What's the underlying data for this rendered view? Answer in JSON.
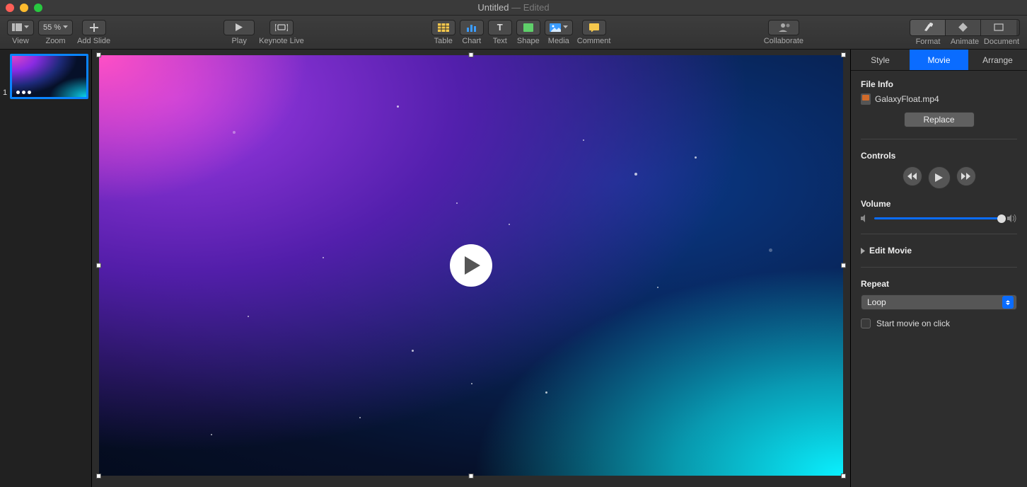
{
  "window": {
    "title": "Untitled",
    "subtitle": " — Edited"
  },
  "toolbar": {
    "view": "View",
    "zoom_value": "55 %",
    "zoom": "Zoom",
    "add_slide": "Add Slide",
    "play": "Play",
    "keynote_live": "Keynote Live",
    "table": "Table",
    "chart": "Chart",
    "text": "Text",
    "shape": "Shape",
    "media": "Media",
    "comment": "Comment",
    "collaborate": "Collaborate",
    "format": "Format",
    "animate": "Animate",
    "document": "Document"
  },
  "navigator": {
    "slides": [
      {
        "number": "1"
      }
    ]
  },
  "inspector": {
    "tabs": {
      "style": "Style",
      "movie": "Movie",
      "arrange": "Arrange"
    },
    "active_tab": "Movie",
    "file_info_label": "File Info",
    "file_name": "GalaxyFloat.mp4",
    "replace": "Replace",
    "controls_label": "Controls",
    "volume_label": "Volume",
    "volume_percent": 100,
    "edit_movie": "Edit Movie",
    "repeat_label": "Repeat",
    "repeat_value": "Loop",
    "start_on_click": "Start movie on click",
    "start_on_click_checked": false
  }
}
